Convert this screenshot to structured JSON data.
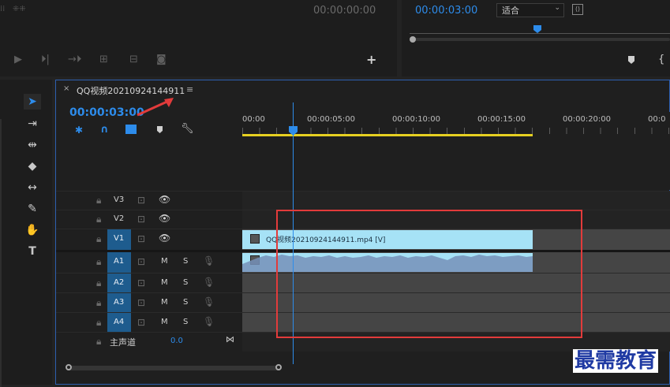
{
  "source_monitor": {
    "timecode": "00:00:00:00"
  },
  "program_monitor": {
    "timecode": "00:00:03:00",
    "zoom_select": "适合"
  },
  "timeline": {
    "tab_title": "QQ视频20210924144911",
    "playhead_timecode": "00:00:03:00",
    "ruler": [
      "00:00",
      "00:00:05:00",
      "00:00:10:00",
      "00:00:15:00",
      "00:00:20:00",
      "00:0"
    ],
    "video_tracks": [
      {
        "name": "V3",
        "active": false
      },
      {
        "name": "V2",
        "active": false
      },
      {
        "name": "V1",
        "active": true
      }
    ],
    "audio_tracks": [
      {
        "name": "A1",
        "m": "M",
        "s": "S"
      },
      {
        "name": "A2",
        "m": "M",
        "s": "S"
      },
      {
        "name": "A3",
        "m": "M",
        "s": "S"
      },
      {
        "name": "A4",
        "m": "M",
        "s": "S"
      }
    ],
    "master": {
      "label": "主声道",
      "value": "0.0"
    },
    "video_clip_label": "QQ视频20210924144911.mp4 [V]"
  },
  "watermark": "最需教育",
  "colors": {
    "accent": "#2d8ceb",
    "clip": "#a6e2f6",
    "annotation": "#e23b3b"
  }
}
